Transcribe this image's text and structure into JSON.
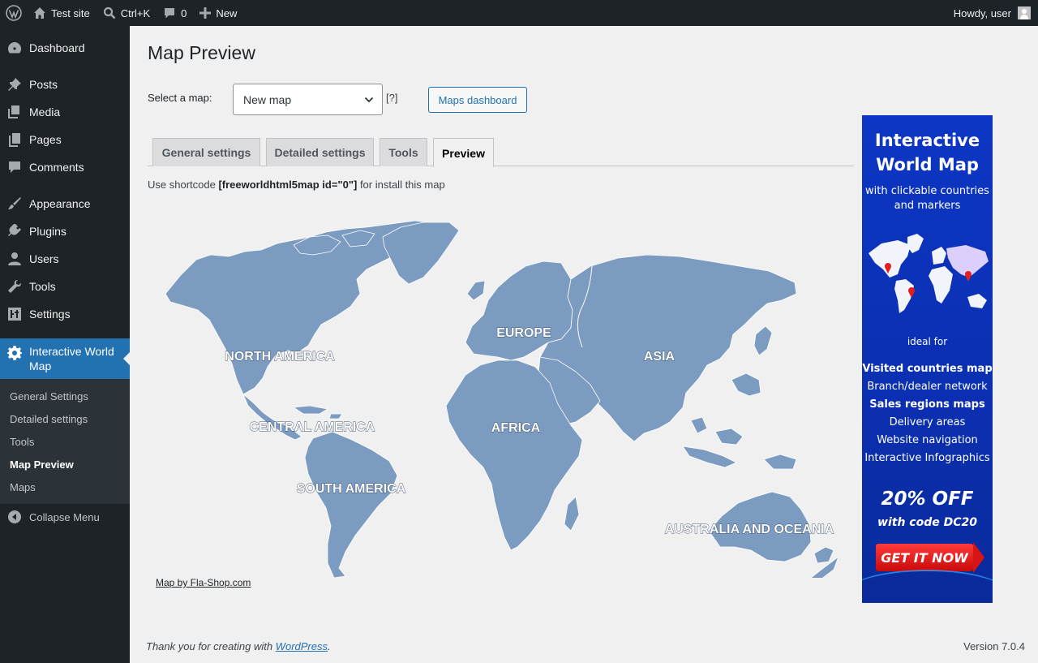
{
  "adminbar": {
    "site_name": "Test site",
    "search_shortcut": "Ctrl+K",
    "comments_count": "0",
    "new_label": "New",
    "howdy": "Howdy, user"
  },
  "menu": {
    "items": [
      {
        "label": "Dashboard"
      },
      {
        "label": "Posts"
      },
      {
        "label": "Media"
      },
      {
        "label": "Pages"
      },
      {
        "label": "Comments"
      },
      {
        "label": "Appearance"
      },
      {
        "label": "Plugins"
      },
      {
        "label": "Users"
      },
      {
        "label": "Tools"
      },
      {
        "label": "Settings"
      }
    ],
    "current_line1": "Interactive World",
    "current_line2": "Map",
    "submenu": [
      {
        "label": "General Settings"
      },
      {
        "label": "Detailed settings"
      },
      {
        "label": "Tools"
      },
      {
        "label": "Map Preview"
      },
      {
        "label": "Maps"
      }
    ],
    "collapse": "Collapse Menu"
  },
  "page": {
    "title": "Map Preview",
    "select_label": "Select a map:",
    "select_value": "New map",
    "help": "[?]",
    "dashboard_button": "Maps dashboard",
    "tabs": [
      {
        "label": "General settings"
      },
      {
        "label": "Detailed settings"
      },
      {
        "label": "Tools"
      },
      {
        "label": "Preview"
      }
    ],
    "shortcode_pre": "Use shortcode ",
    "shortcode_code": "[freeworldhtml5map id=\"0\"]",
    "shortcode_post": " for install this map",
    "map_credit": "Map by Fla-Shop.com"
  },
  "map": {
    "land_color": "#7b9bc0",
    "labels": {
      "north_america": "NORTH AMERICA",
      "central_america": "CENTRAL AMERICA",
      "south_america": "SOUTH AMERICA",
      "europe": "EUROPE",
      "africa": "AFRICA",
      "asia": "ASIA",
      "oceania": "AUSTRALIA AND OCEANIA"
    }
  },
  "ad": {
    "title_line1": "Interactive",
    "title_line2": "World Map",
    "sub_line1": "with clickable countries",
    "sub_line2": "and markers",
    "ideal": "ideal for",
    "list": [
      "Visited countries map",
      "Branch/dealer network",
      "Sales regions maps",
      "Delivery areas",
      "Website navigation",
      "Interactive Infographics"
    ],
    "discount": "20% OFF",
    "code": "with code DC20",
    "cta": "GET IT NOW"
  },
  "footer": {
    "thanks": "Thank you for creating with ",
    "link": "WordPress",
    "period": ".",
    "version": "Version 7.0.4"
  }
}
